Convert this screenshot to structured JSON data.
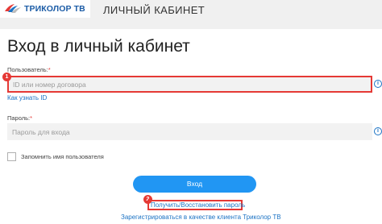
{
  "header": {
    "logo_text": "ТРИКОЛОР ТВ",
    "title": "ЛИЧНЫЙ КАБИНЕТ"
  },
  "page": {
    "title": "Вход в личный кабинет"
  },
  "form": {
    "username": {
      "label": "Пользователь:",
      "required_mark": "*",
      "placeholder": "ID или номер договора",
      "value": ""
    },
    "find_id_link": "Как узнать ID",
    "password": {
      "label": "Пароль:",
      "required_mark": "*",
      "placeholder": "Пароль для входа",
      "value": ""
    },
    "remember_label": "Запомнить имя пользователя",
    "remember_checked": false,
    "login_button": "Вход",
    "recover_link": "Получить/Восстановить пароль",
    "register_link": "Зарегистрироваться в качестве клиента Триколор ТВ"
  },
  "annotations": {
    "marker_1": "1",
    "marker_2": "2"
  },
  "icons": {
    "info": "info-icon",
    "logo": "tricolor-logo-icon"
  },
  "colors": {
    "brand_blue": "#1c5ca6",
    "link_blue": "#1c73c4",
    "button_blue": "#2196f3",
    "highlight_red": "#e53935",
    "input_bg": "#f2f2f2",
    "header_bg": "#f0f0f0"
  }
}
